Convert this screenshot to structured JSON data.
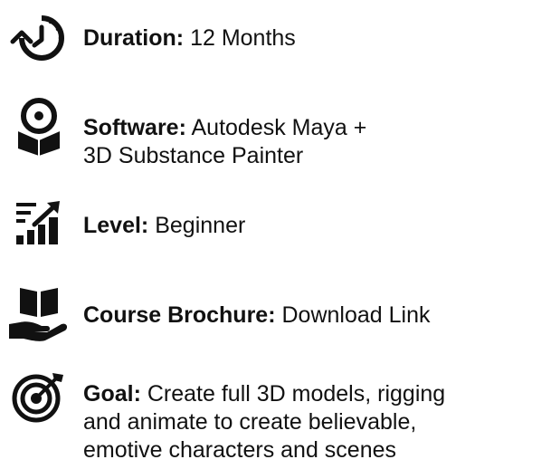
{
  "items": [
    {
      "icon": "clock-rotate-icon",
      "label": "Duration:",
      "value": "12 Months",
      "value_line2": ""
    },
    {
      "icon": "software-cube-icon",
      "label": "Software:",
      "value": "Autodesk Maya  +",
      "value_line2": "3D Substance Painter"
    },
    {
      "icon": "level-chart-icon",
      "label": "Level:",
      "value": "Beginner",
      "value_line2": ""
    },
    {
      "icon": "brochure-hand-icon",
      "label": "Course Brochure:",
      "value": "Download Link",
      "value_line2": ""
    },
    {
      "icon": "target-icon",
      "label": "Goal:",
      "value": "Create full 3D models, rigging",
      "value_line2": "and animate to create believable,",
      "value_line3": "emotive characters and scenes"
    }
  ],
  "colors": {
    "text": "#111111",
    "icon": "#111111",
    "background": "#ffffff"
  }
}
